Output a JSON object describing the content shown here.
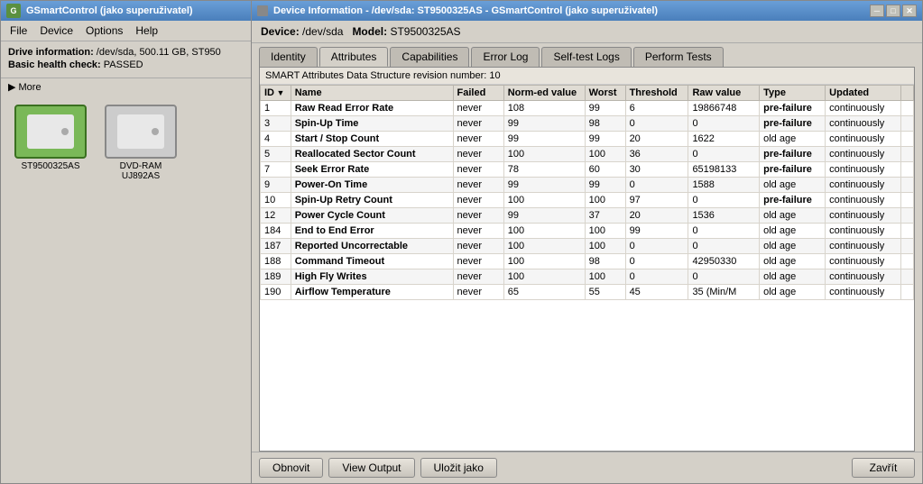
{
  "app": {
    "title": "GSmartControl (jako superuživatel)",
    "menu": [
      "File",
      "Device",
      "Options",
      "Help"
    ],
    "drive_info_label": "Drive information:",
    "drive_info_value": "/dev/sda, 500.11 GB, ST950",
    "health_label": "Basic health check:",
    "health_value": "PASSED",
    "more_label": "▶ More",
    "drives": [
      {
        "id": "st9500",
        "label": "ST9500325AS",
        "type": "selected"
      },
      {
        "id": "dvdram",
        "label": "DVD-RAM UJ892AS",
        "type": "plain"
      }
    ]
  },
  "dialog": {
    "title": "Device Information - /dev/sda: ST9500325AS - GSmartControl (jako superuživatel)",
    "device_label": "Device:",
    "device_value": "/dev/sda",
    "model_label": "Model:",
    "model_value": "ST9500325AS",
    "tabs": [
      {
        "id": "identity",
        "label": "Identity"
      },
      {
        "id": "attributes",
        "label": "Attributes",
        "active": true
      },
      {
        "id": "capabilities",
        "label": "Capabilities"
      },
      {
        "id": "error_log",
        "label": "Error Log"
      },
      {
        "id": "selftest_logs",
        "label": "Self-test Logs"
      },
      {
        "id": "perform_tests",
        "label": "Perform Tests"
      }
    ],
    "table": {
      "subtitle": "SMART Attributes Data Structure revision number: 10",
      "columns": [
        "ID",
        "Name",
        "Failed",
        "Norm-ed value",
        "Worst",
        "Threshold",
        "Raw value",
        "Type",
        "Updated",
        ""
      ],
      "rows": [
        {
          "id": "1",
          "name": "Raw Read Error Rate",
          "failed": "never",
          "norm": "108",
          "worst": "99",
          "threshold": "6",
          "raw": "19866748",
          "type": "pre-failure",
          "updated": "continuously",
          "extra": ""
        },
        {
          "id": "3",
          "name": "Spin-Up Time",
          "failed": "never",
          "norm": "99",
          "worst": "98",
          "threshold": "0",
          "raw": "0",
          "type": "pre-failure",
          "updated": "continuously",
          "extra": ""
        },
        {
          "id": "4",
          "name": "Start / Stop Count",
          "failed": "never",
          "norm": "99",
          "worst": "99",
          "threshold": "20",
          "raw": "1622",
          "type": "old age",
          "updated": "continuously",
          "extra": ""
        },
        {
          "id": "5",
          "name": "Reallocated Sector Count",
          "failed": "never",
          "norm": "100",
          "worst": "100",
          "threshold": "36",
          "raw": "0",
          "type": "pre-failure",
          "updated": "continuously",
          "extra": ""
        },
        {
          "id": "7",
          "name": "Seek Error Rate",
          "failed": "never",
          "norm": "78",
          "worst": "60",
          "threshold": "30",
          "raw": "65198133",
          "type": "pre-failure",
          "updated": "continuously",
          "extra": ""
        },
        {
          "id": "9",
          "name": "Power-On Time",
          "failed": "never",
          "norm": "99",
          "worst": "99",
          "threshold": "0",
          "raw": "1588",
          "type": "old age",
          "updated": "continuously",
          "extra": ""
        },
        {
          "id": "10",
          "name": "Spin-Up Retry Count",
          "failed": "never",
          "norm": "100",
          "worst": "100",
          "threshold": "97",
          "raw": "0",
          "type": "pre-failure",
          "updated": "continuously",
          "extra": ""
        },
        {
          "id": "12",
          "name": "Power Cycle Count",
          "failed": "never",
          "norm": "99",
          "worst": "37",
          "threshold": "20",
          "raw": "1536",
          "type": "old age",
          "updated": "continuously",
          "extra": ""
        },
        {
          "id": "184",
          "name": "End to End Error",
          "failed": "never",
          "norm": "100",
          "worst": "100",
          "threshold": "99",
          "raw": "0",
          "type": "old age",
          "updated": "continuously",
          "extra": ""
        },
        {
          "id": "187",
          "name": "Reported Uncorrectable",
          "failed": "never",
          "norm": "100",
          "worst": "100",
          "threshold": "0",
          "raw": "0",
          "type": "old age",
          "updated": "continuously",
          "extra": ""
        },
        {
          "id": "188",
          "name": "Command Timeout",
          "failed": "never",
          "norm": "100",
          "worst": "98",
          "threshold": "0",
          "raw": "42950330",
          "type": "old age",
          "updated": "continuously",
          "extra": ""
        },
        {
          "id": "189",
          "name": "High Fly Writes",
          "failed": "never",
          "norm": "100",
          "worst": "100",
          "threshold": "0",
          "raw": "0",
          "type": "old age",
          "updated": "continuously",
          "extra": ""
        },
        {
          "id": "190",
          "name": "Airflow Temperature",
          "failed": "never",
          "norm": "65",
          "worst": "55",
          "threshold": "45",
          "raw": "35 (Min/M",
          "type": "old age",
          "updated": "continuously",
          "extra": ""
        }
      ]
    },
    "buttons": {
      "refresh": "Obnovit",
      "view_output": "View Output",
      "save_as": "Uložit jako",
      "close": "Zavřít"
    }
  }
}
